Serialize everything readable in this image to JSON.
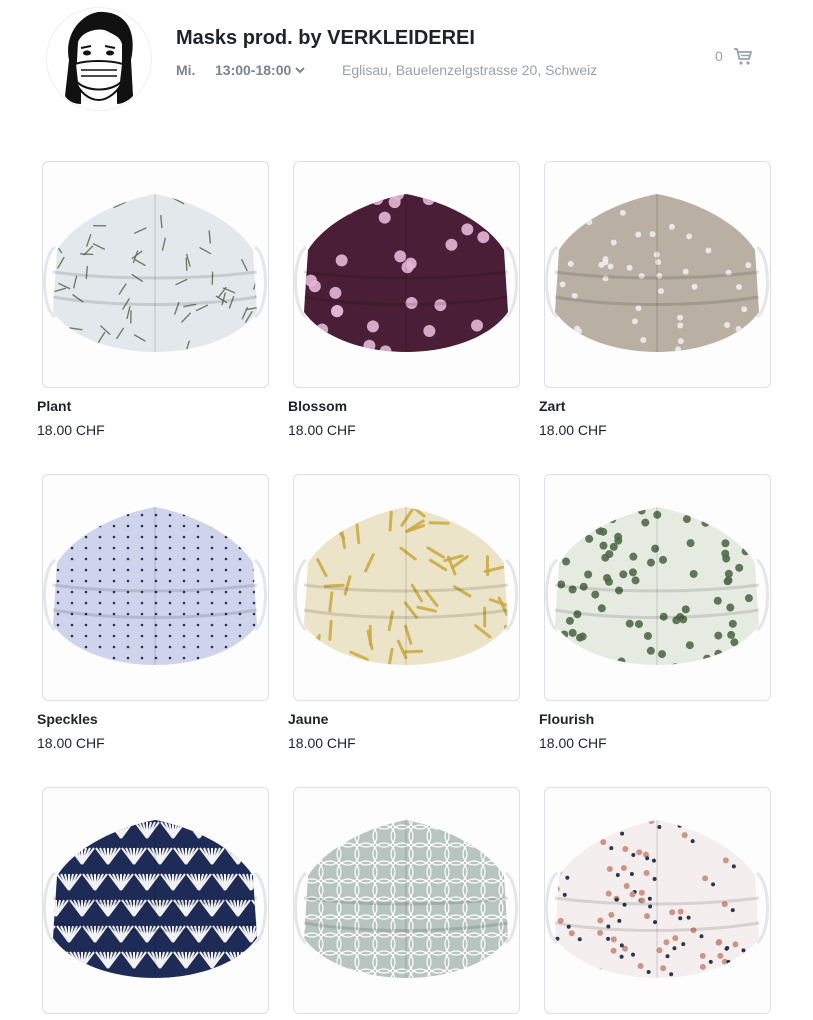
{
  "shop": {
    "title": "Masks prod. by VERKLEIDEREI",
    "day": "Mi.",
    "hours": "13:00-18:00",
    "address": "Eglisau, Bauelenzelgstrasse 20, Schweiz",
    "logo_icon": "masked-face-logo-icon"
  },
  "cart": {
    "count": "0",
    "icon": "cart-icon"
  },
  "products": [
    {
      "name": "Plant",
      "price": "18.00 CHF",
      "bg": "#e3e8ec",
      "accent": "#5c6b4e",
      "pattern": "leaves"
    },
    {
      "name": "Blossom",
      "price": "18.00 CHF",
      "bg": "#4a1e36",
      "accent": "#e6b6d6",
      "pattern": "flowers"
    },
    {
      "name": "Zart",
      "price": "18.00 CHF",
      "bg": "#b9afa3",
      "accent": "#f2ecef",
      "pattern": "tiny-flowers"
    },
    {
      "name": "Speckles",
      "price": "18.00 CHF",
      "bg": "#cfd3ec",
      "accent": "#2b3158",
      "pattern": "dots"
    },
    {
      "name": "Jaune",
      "price": "18.00 CHF",
      "bg": "#ece4c8",
      "accent": "#c9a83d",
      "pattern": "fern"
    },
    {
      "name": "Flourish",
      "price": "18.00 CHF",
      "bg": "#e6ebe2",
      "accent": "#4f6a47",
      "pattern": "floral"
    },
    {
      "name": "",
      "price": "",
      "bg": "#1f2b57",
      "accent": "#f2f2f2",
      "pattern": "fan"
    },
    {
      "name": "",
      "price": "",
      "bg": "#b8c4c0",
      "accent": "#ffffff",
      "pattern": "lattice"
    },
    {
      "name": "",
      "price": "",
      "bg": "#f4efee",
      "accent": "#c98a77",
      "pattern": "folk"
    }
  ]
}
